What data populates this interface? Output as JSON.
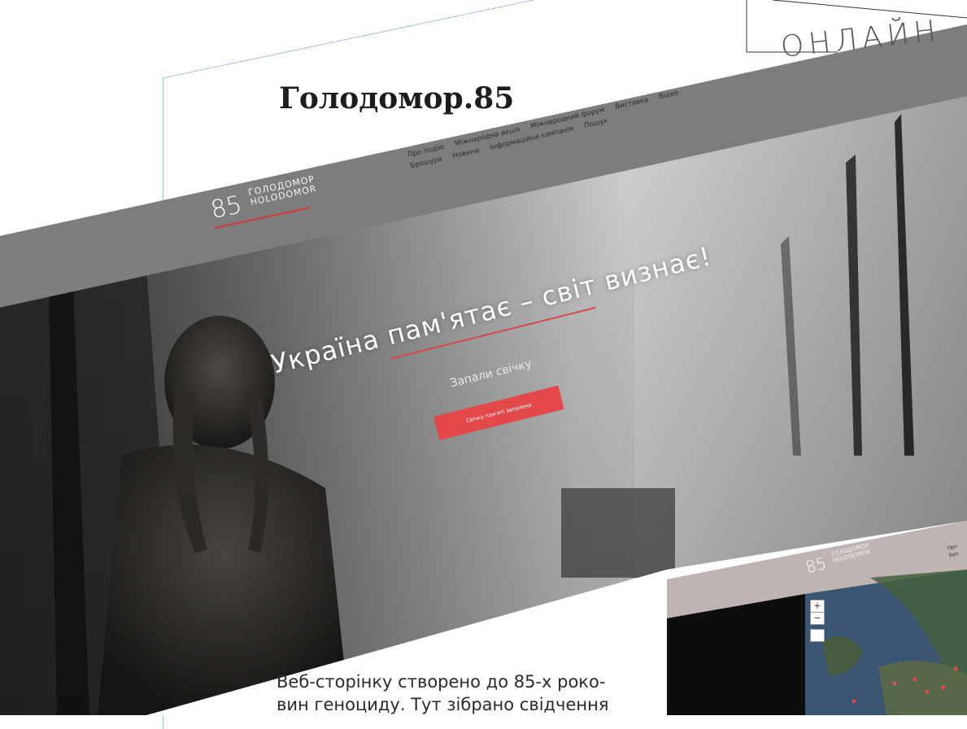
{
  "badge": {
    "label": "ОНЛАЙН"
  },
  "title": "Голодомор.85",
  "site": {
    "logo_number": "85",
    "logo_line1": "ГОЛОДОМОР",
    "logo_line2": "HOLODOMOR",
    "nav": [
      "Про подію",
      "Міжнародна акція",
      "Міжнародний форум",
      "Виставка",
      "Відео",
      "Брошура",
      "Новини",
      "Інформаційна кампанія",
      "Пошук"
    ],
    "hero_title": "Україна пам'ятає – світ визнає!",
    "hero_subtitle": "Запали свічку",
    "hero_button": "Свічка пам'яті запалена"
  },
  "map_inset": {
    "logo_number": "85",
    "logo_line1": "ГОЛОДОМОР",
    "logo_line2": "HOLODOMOR",
    "nav_partial_1": "Про",
    "nav_partial_2": "Бро",
    "zoom_in": "+",
    "zoom_out": "−"
  },
  "body": {
    "line1": "Веб-сторінку створено до 85-х роко-",
    "line2": "вин геноциду. Тут зібрано свідчення"
  },
  "colors": {
    "header_band": "#7d7d7d",
    "accent_red": "#e3484b",
    "frame_line": "#9fc3d6"
  }
}
